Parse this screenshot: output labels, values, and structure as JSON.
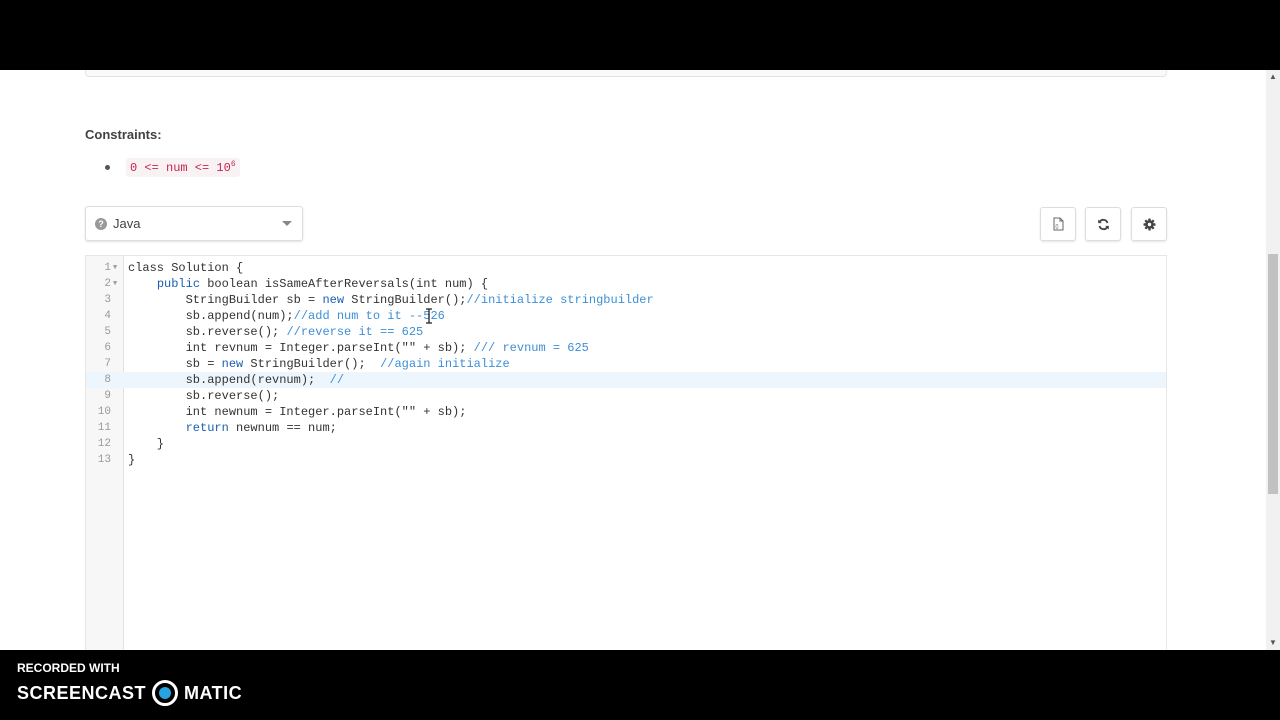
{
  "constraints": {
    "title": "Constraints:",
    "expr": "0 <= num <= 10",
    "exponent": "6"
  },
  "language_select": {
    "help_icon": "?",
    "selected": "Java"
  },
  "toolbar": {
    "icons": [
      "document-icon",
      "refresh-icon",
      "gear-icon"
    ]
  },
  "editor": {
    "active_line": 8,
    "lines": [
      {
        "n": "1",
        "fold": true
      },
      {
        "n": "2",
        "fold": true
      },
      {
        "n": "3"
      },
      {
        "n": "4"
      },
      {
        "n": "5"
      },
      {
        "n": "6"
      },
      {
        "n": "7"
      },
      {
        "n": "8"
      },
      {
        "n": "9"
      },
      {
        "n": "10"
      },
      {
        "n": "11"
      },
      {
        "n": "12"
      },
      {
        "n": "13"
      }
    ],
    "code": {
      "l1": "class Solution {",
      "l2a": "    ",
      "l2kw": "public",
      "l2b": " boolean isSameAfterReversals(int num) {",
      "l3a": "        StringBuilder sb = ",
      "l3kw": "new",
      "l3b": " StringBuilder();",
      "l3c": "//initialize stringbuilder",
      "l4a": "        sb.append(num);",
      "l4c": "//add num to it --526",
      "l5a": "        sb.reverse(); ",
      "l5c": "//reverse it == 625",
      "l6a": "        int revnum = Integer.parseInt(\"\" + sb); ",
      "l6c": "/// revnum = 625",
      "l7a": "        sb = ",
      "l7kw": "new",
      "l7b": " StringBuilder();  ",
      "l7c": "//again initialize",
      "l8a": "        sb.append(revnum);  ",
      "l8c": "//",
      "l9": "        sb.reverse();",
      "l10": "        int newnum = Integer.parseInt(\"\" + sb);",
      "l11a": "        ",
      "l11kw": "return",
      "l11b": " newnum == num;",
      "l12": "    }",
      "l13": "}"
    }
  },
  "watermark": {
    "recorded_with": "RECORDED WITH",
    "brand_left": "SCREENCAST",
    "brand_right": "MATIC"
  },
  "colors": {
    "keyword": "#1a5fb4",
    "comment": "#3d8fd6",
    "logo": "#29a3e0",
    "active_line": "#eef6fd"
  }
}
